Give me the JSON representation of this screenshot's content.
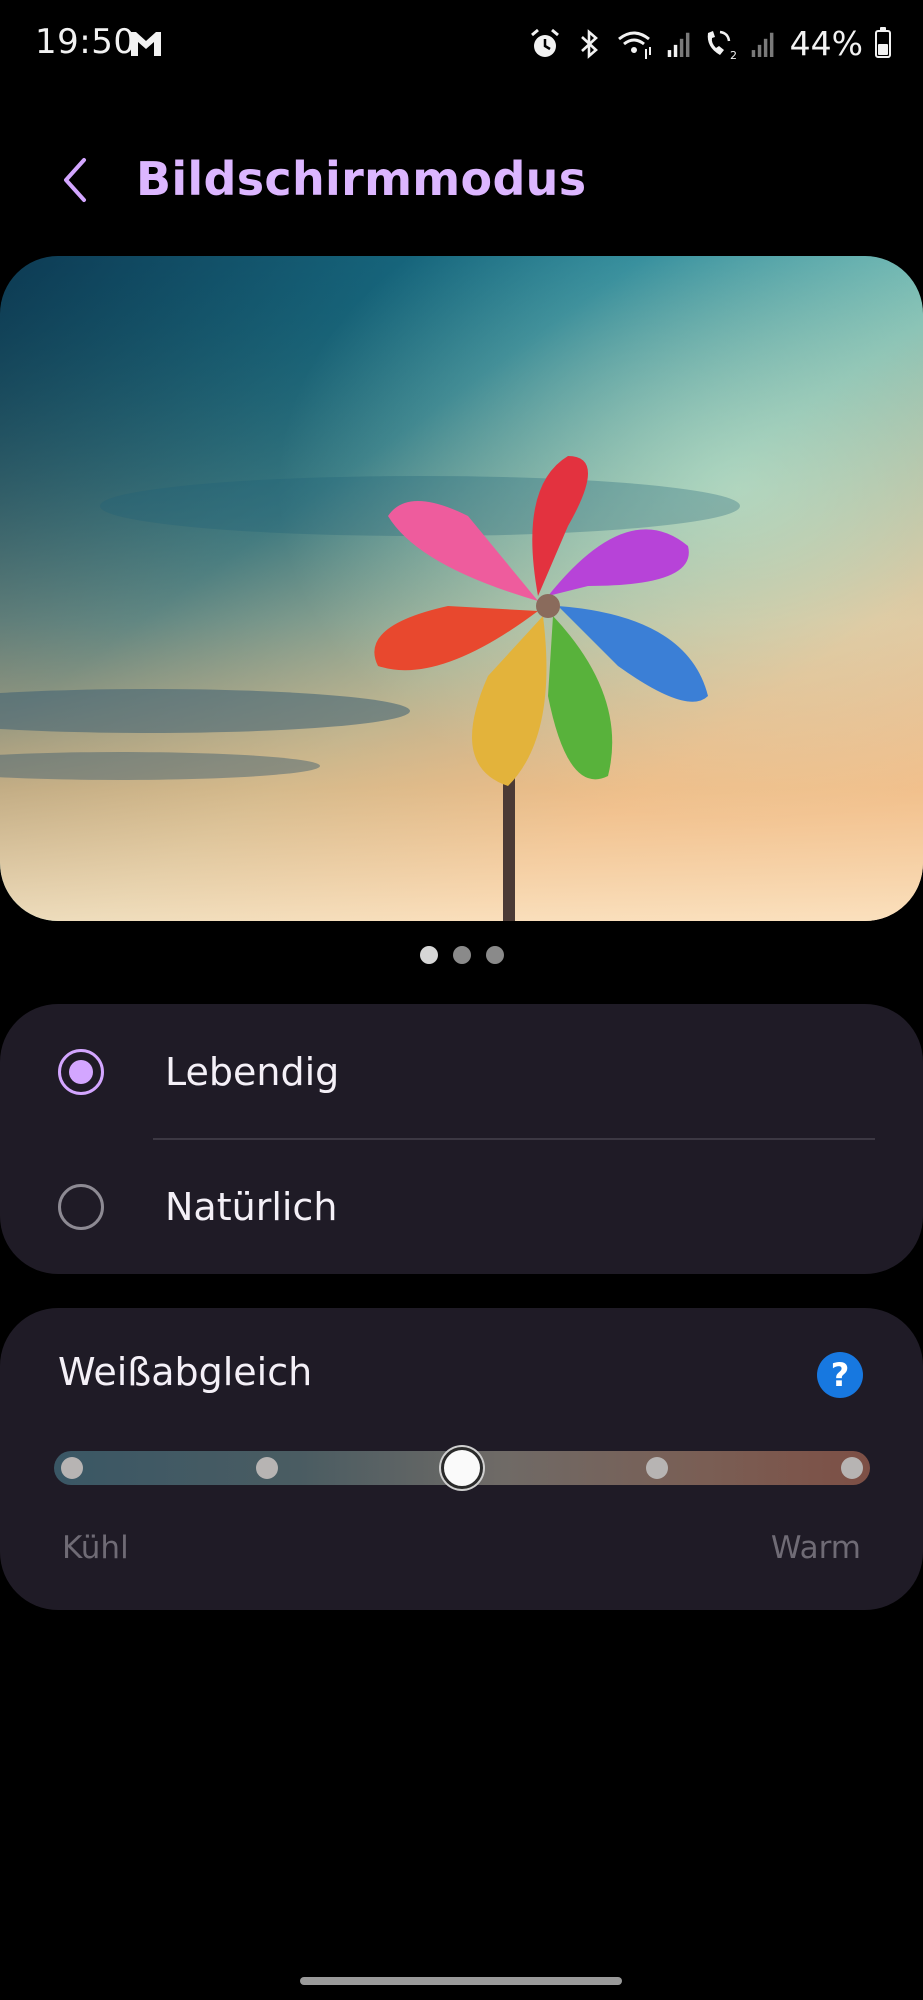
{
  "status_bar": {
    "time": "19:50",
    "battery_text": "44%",
    "battery_level": 0.44,
    "icons": [
      "gmail-icon",
      "alarm-icon",
      "bluetooth-icon",
      "wifi-calling-icon",
      "signal-icon",
      "volte-call-icon",
      "signal-icon-2"
    ]
  },
  "header": {
    "back_icon": "chevron-left-icon",
    "title": "Bildschirmmodus"
  },
  "preview": {
    "image": "pinwheel-sunset-image",
    "pager": {
      "count": 3,
      "active_index": 0
    }
  },
  "screen_mode": {
    "options": [
      {
        "label": "Lebendig",
        "selected": true
      },
      {
        "label": "Natürlich",
        "selected": false
      }
    ]
  },
  "white_balance": {
    "title": "Weißabgleich",
    "help_icon": "?",
    "steps": 5,
    "selected_step": 3,
    "min_label": "Kühl",
    "max_label": "Warm"
  },
  "colors": {
    "accent": "#dcb6ff",
    "radio_active": "#d3a6ff",
    "card_bg": "#1f1b26",
    "help_blue": "#1778e0",
    "background": "#000000"
  }
}
